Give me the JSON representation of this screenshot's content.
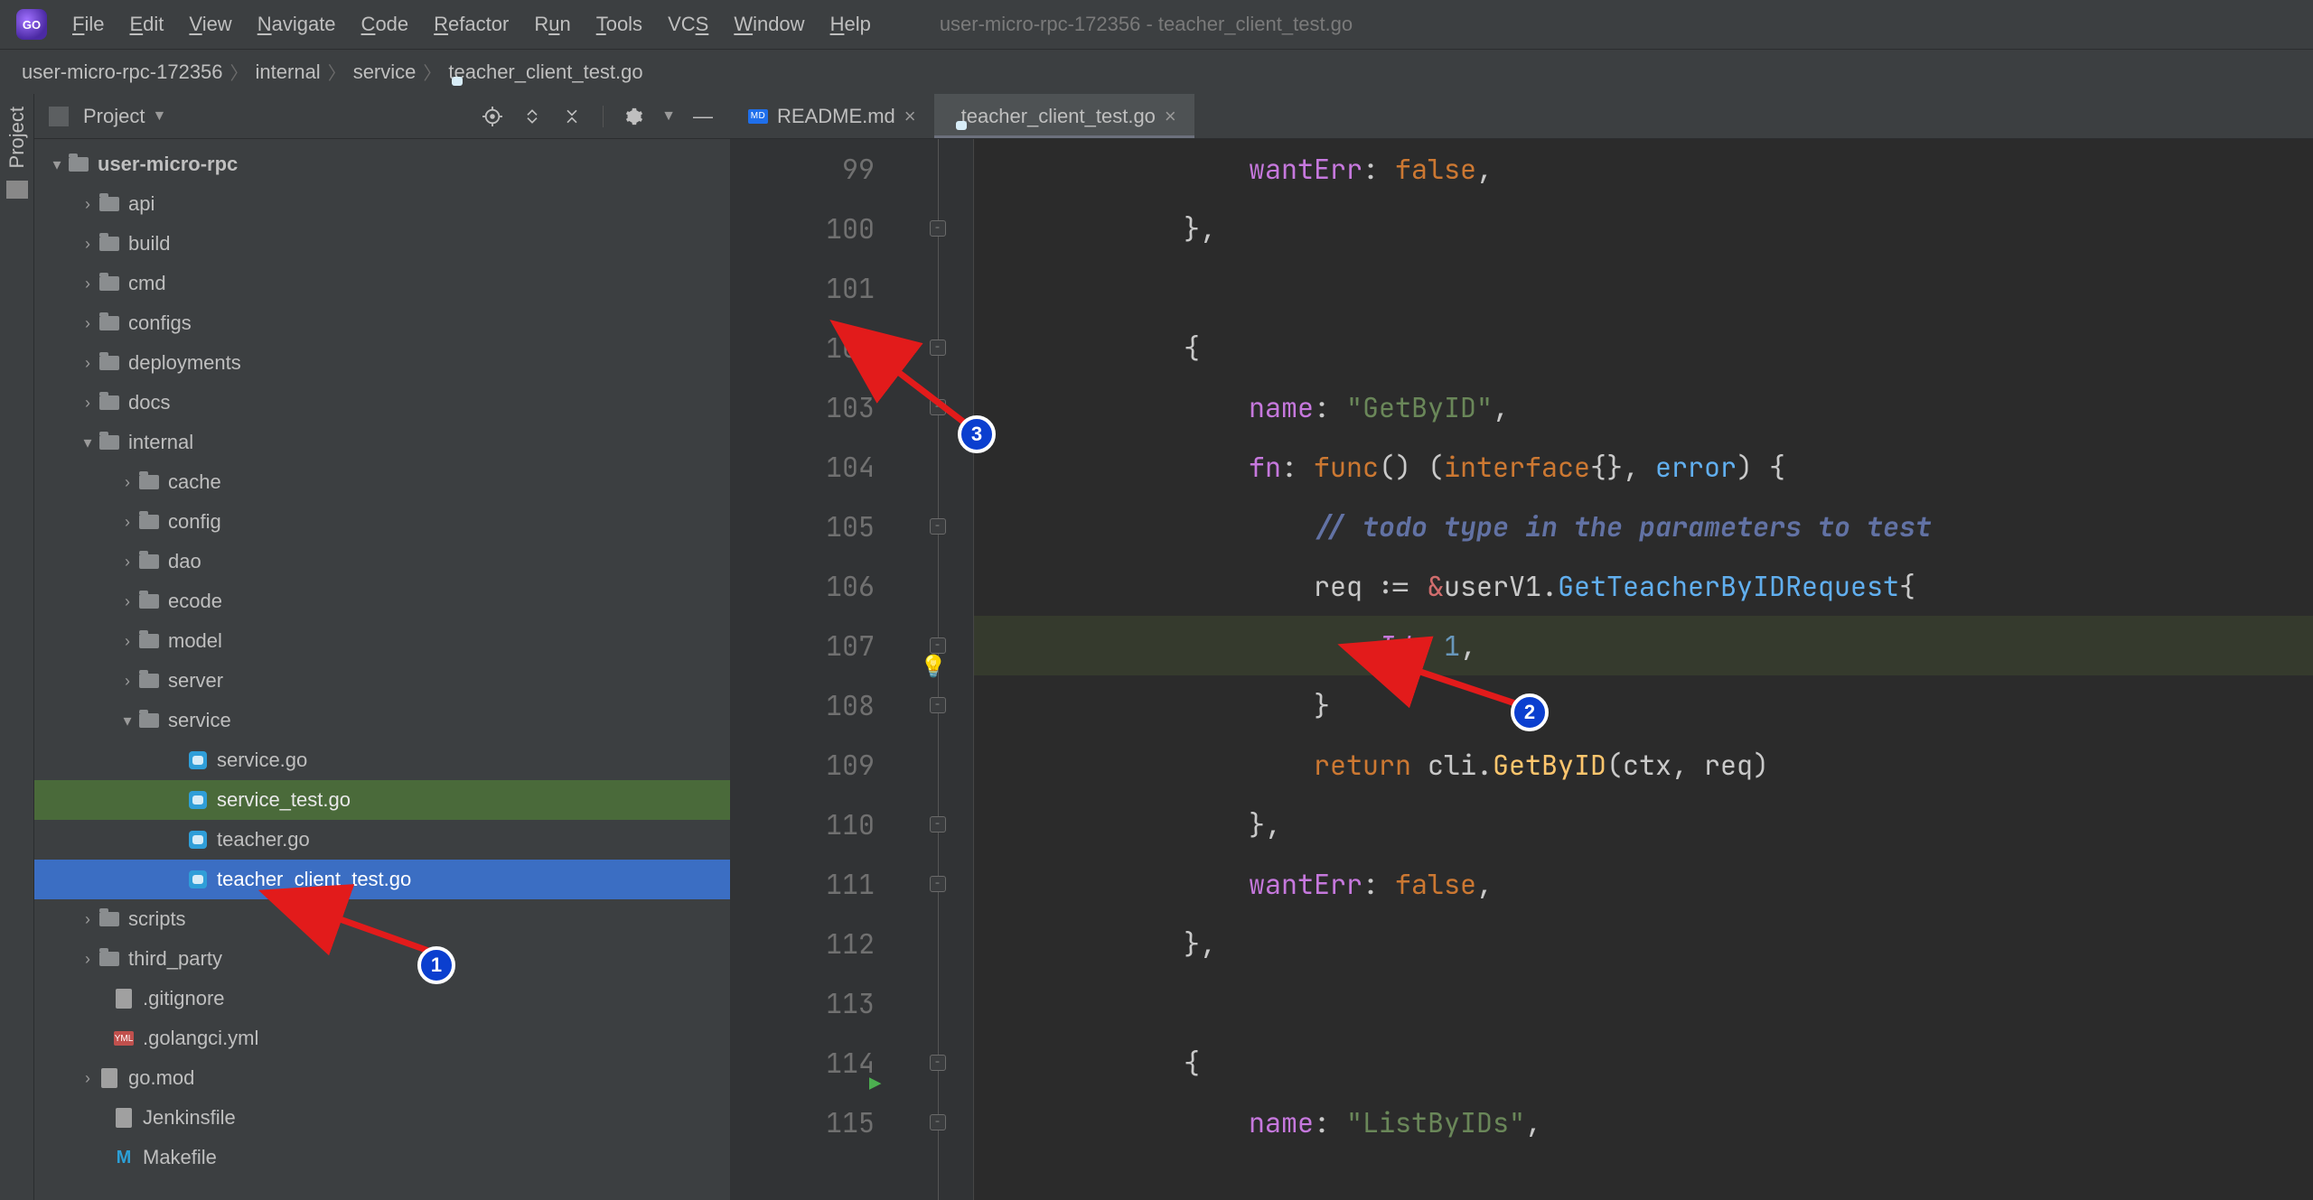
{
  "window": {
    "title": "user-micro-rpc-172356 - teacher_client_test.go"
  },
  "menu": {
    "file": "File",
    "edit": "Edit",
    "view": "View",
    "navigate": "Navigate",
    "code": "Code",
    "refactor": "Refactor",
    "run": "Run",
    "tools": "Tools",
    "vcs": "VCS",
    "window": "Window",
    "help": "Help"
  },
  "crumbs": {
    "c0": "user-micro-rpc-172356",
    "c1": "internal",
    "c2": "service",
    "c3": "teacher_client_test.go"
  },
  "leftrail": {
    "project": "Project"
  },
  "sidebar": {
    "title": "Project",
    "root": "user-micro-rpc",
    "api": "api",
    "build": "build",
    "cmd": "cmd",
    "configs": "configs",
    "deployments": "deployments",
    "docs": "docs",
    "internal": "internal",
    "cache": "cache",
    "config": "config",
    "dao": "dao",
    "ecode": "ecode",
    "model": "model",
    "server": "server",
    "service": "service",
    "svc_go": "service.go",
    "svc_test": "service_test.go",
    "teacher_go": "teacher.go",
    "teacher_test": "teacher_client_test.go",
    "scripts": "scripts",
    "third_party": "third_party",
    "gitignore": ".gitignore",
    "golangci": ".golangci.yml",
    "gomod": "go.mod",
    "jenkins": "Jenkinsfile",
    "makefile": "Makefile"
  },
  "tabs": {
    "t0": "README.md",
    "t1": "teacher_client_test.go"
  },
  "gutter": {
    "l99": "99",
    "l100": "100",
    "l101": "101",
    "l102": "102",
    "l103": "103",
    "l104": "104",
    "l105": "105",
    "l106": "106",
    "l107": "107",
    "l108": "108",
    "l109": "109",
    "l110": "110",
    "l111": "111",
    "l112": "112",
    "l113": "113",
    "l114": "114",
    "l115": "115"
  },
  "code": {
    "l99": {
      "indent": "                ",
      "fld": "wantErr",
      "rest": ": ",
      "val": "false",
      "tail": ","
    },
    "l100": {
      "indent": "            ",
      "text": "},"
    },
    "l101": {
      "indent": "",
      "text": ""
    },
    "l102": {
      "indent": "            ",
      "text": "{"
    },
    "l103": {
      "indent": "                ",
      "fld": "name",
      "rest": ": ",
      "str": "\"GetByID\"",
      "tail": ","
    },
    "l104": {
      "indent": "                ",
      "fld": "fn",
      "rest": ": ",
      "kw": "func",
      "par": "() (",
      "ifc": "interface",
      "braces": "{}",
      "sep": ", ",
      "err": "error",
      "close": ") {"
    },
    "l105": {
      "indent": "                    ",
      "cmt": "// todo type in the parameters to test"
    },
    "l106": {
      "indent": "                    ",
      "ident": "req",
      "op": " := ",
      "amp": "&",
      "pkg": "userV1",
      "dot": ".",
      "typ": "GetTeacherByIDRequest",
      "open": "{"
    },
    "l107": {
      "indent": "                        ",
      "field": "Id",
      "sep": ": ",
      "num": "1",
      "tail": ","
    },
    "l108": {
      "indent": "                    ",
      "text": "}"
    },
    "l109": {
      "indent": "                    ",
      "kw": "return ",
      "obj": "cli",
      "dot": ".",
      "fn": "GetByID",
      "args": "(ctx, req)"
    },
    "l110": {
      "indent": "                ",
      "text": "},"
    },
    "l111": {
      "indent": "                ",
      "fld": "wantErr",
      "rest": ": ",
      "val": "false",
      "tail": ","
    },
    "l112": {
      "indent": "            ",
      "text": "},"
    },
    "l113": {
      "indent": "",
      "text": ""
    },
    "l114": {
      "indent": "            ",
      "text": "{"
    },
    "l115": {
      "indent": "                ",
      "fld": "name",
      "rest": ": ",
      "str": "\"ListByIDs\"",
      "tail": ","
    }
  },
  "callouts": {
    "n1": "1",
    "n2": "2",
    "n3": "3"
  }
}
